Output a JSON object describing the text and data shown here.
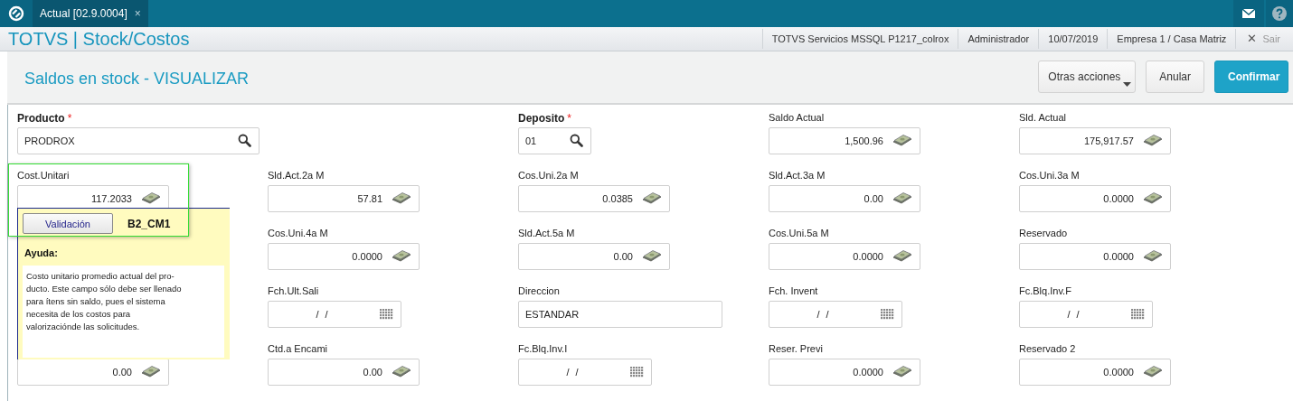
{
  "top_bar": {
    "tabs": [
      {
        "label": "Actual [02.9.0004]",
        "selected": true,
        "close": "×"
      }
    ]
  },
  "header": {
    "title": "TOTVS | Stock/Costos",
    "info": [
      "TOTVS Servicios MSSQL P1217_colrox",
      "Administrador",
      "10/07/2019",
      "Empresa 1 / Casa Matriz"
    ],
    "exit": {
      "icon": "✕",
      "label": "Sair"
    }
  },
  "page": {
    "title": "Saldos en stock - VISUALIZAR",
    "actions": [
      {
        "label": "Otras acciones",
        "kind": "menu"
      },
      {
        "label": "Anular",
        "kind": "secondary"
      },
      {
        "label": "Confirmar",
        "kind": "primary"
      }
    ]
  },
  "form": {
    "rows": [
      [
        {
          "label": "Producto",
          "required_mark": "*",
          "kind": "lookup",
          "value": "PRODROX"
        },
        "",
        {
          "label": "Deposito",
          "required_mark": "*",
          "kind": "lookup",
          "value": "01"
        },
        {
          "label": "Saldo Actual",
          "kind": "money",
          "value": "1,500.96"
        },
        {
          "label": "Sld. Actual",
          "kind": "money",
          "value": "175,917.57"
        }
      ],
      [
        {
          "label": "Cost.Unitari",
          "kind": "money",
          "value": "117.2033"
        },
        {
          "label": "Sld.Act.2a M",
          "kind": "money",
          "value": "57.81"
        },
        {
          "label": "Cos.Uni.2a M",
          "kind": "money",
          "value": "0.0385"
        },
        {
          "label": "Sld.Act.3a M",
          "kind": "money",
          "value": "0.00"
        },
        {
          "label": "Cos.Uni.3a M",
          "kind": "money",
          "value": "0.0000"
        }
      ],
      [
        "",
        {
          "label": "Cos.Uni.4a M",
          "kind": "money",
          "value": "0.0000"
        },
        {
          "label": "Sld.Act.5a M",
          "kind": "money",
          "value": "0.00"
        },
        {
          "label": "Cos.Uni.5a M",
          "kind": "money",
          "value": "0.0000"
        },
        {
          "label": "Reservado",
          "kind": "money",
          "value": "0.0000"
        }
      ],
      [
        "",
        {
          "label": "Fch.Ult.Sali",
          "kind": "date",
          "value": "/ /"
        },
        {
          "label": "Direccion",
          "kind": "text",
          "value": "ESTANDAR"
        },
        {
          "label": "Fch. Invent",
          "kind": "date",
          "value": "/ /"
        },
        {
          "label": "Fc.Blq.Inv.F",
          "kind": "date",
          "value": "/ /"
        }
      ],
      [
        {
          "kind": "money",
          "value": "0.00"
        },
        {
          "label": "Ctd.a Encami",
          "kind": "money",
          "value": "0.00"
        },
        {
          "label": "Fc.Blq.Inv.I",
          "kind": "date",
          "value": "/ /"
        },
        {
          "label": "Reser. Previ",
          "kind": "money",
          "value": "0.0000"
        },
        {
          "label": "Reservado 2",
          "kind": "money",
          "value": "0.0000"
        }
      ]
    ]
  },
  "help_popup": {
    "button": "Validación",
    "field_id": "B2_CM1",
    "heading": "Ayuda:",
    "text": "Costo unitario promedio actual del pro-\nducto. Este campo sólo debe ser llenado\npara ítens sin saldo, pues el sistema\nnecesita de los costos para\nvalorizaciónde las solicitudes."
  }
}
